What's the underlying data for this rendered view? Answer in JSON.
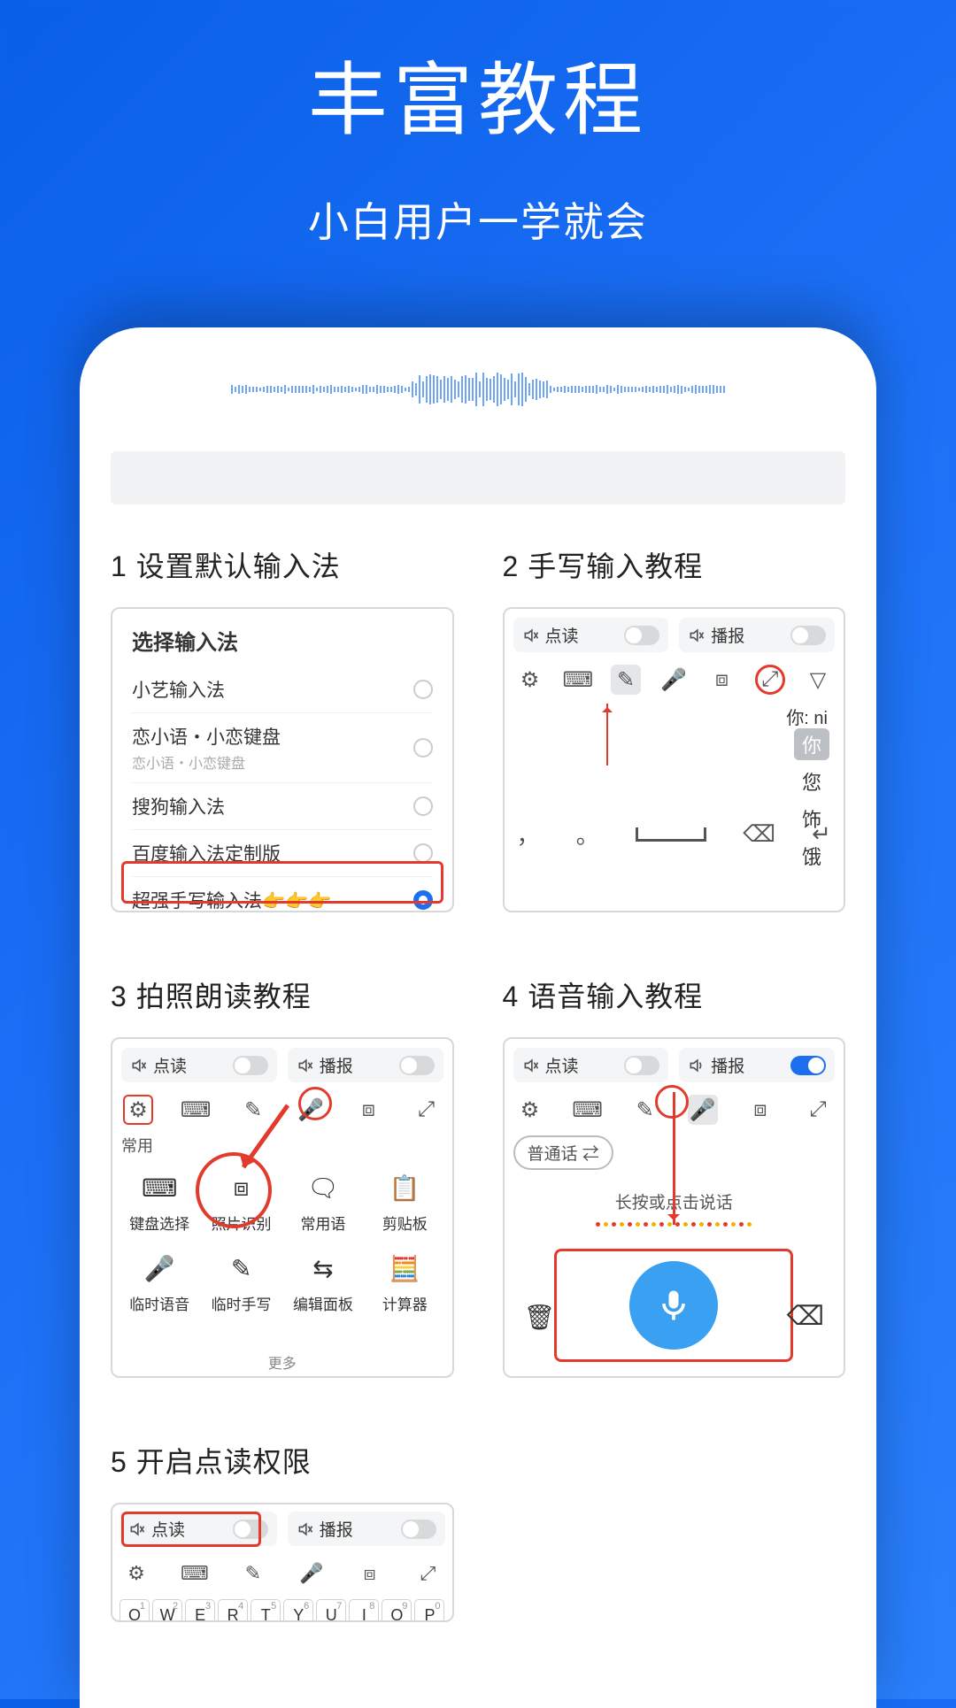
{
  "hero": {
    "title": "丰富教程",
    "subtitle": "小白用户一学就会"
  },
  "sections": {
    "s1": {
      "title": "1 设置默认输入法",
      "picker_title": "选择输入法",
      "items": [
        {
          "label": "小艺输入法",
          "sub": "",
          "selected": false
        },
        {
          "label": "恋小语・小恋键盘",
          "sub": "恋小语・小恋键盘",
          "selected": false
        },
        {
          "label": "搜狗输入法",
          "sub": "",
          "selected": false
        },
        {
          "label": "百度输入法定制版",
          "sub": "",
          "selected": false
        },
        {
          "label": "超强手写输入法👉👉👉",
          "sub": "",
          "selected": true
        }
      ]
    },
    "s2": {
      "title": "2 手写输入教程",
      "toggles": {
        "read": "点读",
        "broadcast": "播报"
      },
      "ni_label": "你: ni",
      "candidates": [
        "你",
        "您",
        "饰",
        "饿"
      ]
    },
    "s3": {
      "title": "3 拍照朗读教程",
      "toggles": {
        "read": "点读",
        "broadcast": "播报"
      },
      "tab": "常用",
      "grid": [
        "键盘选择",
        "照片识别",
        "常用语",
        "剪贴板",
        "临时语音",
        "临时手写",
        "编辑面板",
        "计算器"
      ],
      "more": "更多"
    },
    "s4": {
      "title": "4 语音输入教程",
      "toggles": {
        "read": "点读",
        "broadcast": "播报"
      },
      "lang_chip": "普通话 ⇄",
      "hint": "长按或点击说话"
    },
    "s5": {
      "title": "5 开启点读权限",
      "toggles": {
        "read": "点读",
        "broadcast": "播报"
      },
      "keys": [
        "Q",
        "W",
        "E",
        "R",
        "T",
        "Y",
        "U",
        "I",
        "O",
        "P"
      ],
      "nums": [
        "1",
        "2",
        "3",
        "4",
        "5",
        "6",
        "7",
        "8",
        "9",
        "0"
      ]
    }
  }
}
